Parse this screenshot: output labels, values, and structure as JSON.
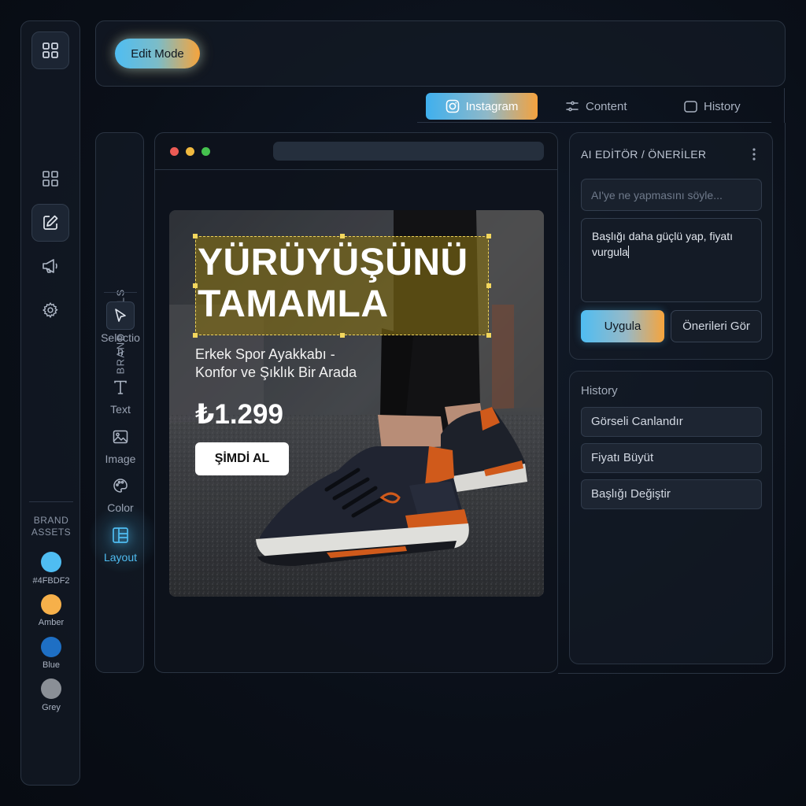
{
  "topbar": {
    "edit_mode_label": "Edit Mode"
  },
  "tabs": [
    {
      "label": "Instagram",
      "icon": "instagram-icon",
      "active": true
    },
    {
      "label": "Content",
      "icon": "sliders-icon",
      "active": false
    },
    {
      "label": "History",
      "icon": "window-icon",
      "active": false
    }
  ],
  "rail": {
    "icons": [
      "grid-icon",
      "dashboard-icon",
      "edit-icon",
      "megaphone-icon",
      "settings-icon"
    ],
    "brand_assets_label": "BRAND\nASSETS",
    "swatches": [
      {
        "label": "#4FBDF2",
        "color": "#4FBDF2"
      },
      {
        "label": "Amber",
        "color": "#F6B04A"
      },
      {
        "label": "Blue",
        "color": "#1E6FC4"
      },
      {
        "label": "Grey",
        "color": "#8A8F96"
      }
    ]
  },
  "tools": {
    "title": "BRAND TOOLS",
    "items": [
      {
        "label": "Selection",
        "icon": "cursor-icon"
      },
      {
        "label": "Text",
        "icon": "text-icon"
      },
      {
        "label": "Image",
        "icon": "image-icon"
      },
      {
        "label": "Color",
        "icon": "palette-icon"
      },
      {
        "label": "Layout",
        "icon": "layout-icon",
        "active": true
      }
    ]
  },
  "ad": {
    "headline": "YÜRÜYÜŞÜNÜ\nTAMAMLA",
    "subtitle": "Erkek Spor Ayakkabı -\nKonfor ve Şıklık Bir Arada",
    "price": "₺1.299",
    "cta": "ŞİMDİ AL"
  },
  "ai_editor": {
    "title": "AI EDİTÖR / ÖNERİLER",
    "input_placeholder": "AI'ye ne yapmasını söyle...",
    "prompt_text": "Başlığı daha güçlü yap, fiyatı vurgula",
    "apply_label": "Uygula",
    "suggestions_label": "Önerileri Gör"
  },
  "history": {
    "title": "History",
    "items": [
      "Görseli Canlandır",
      "Fiyatı Büyüt",
      "Başlığı Değiştir"
    ]
  },
  "colors": {
    "accent_blue": "#4FBDF2",
    "accent_amber": "#F6A43C",
    "background": "#0A0F18"
  }
}
